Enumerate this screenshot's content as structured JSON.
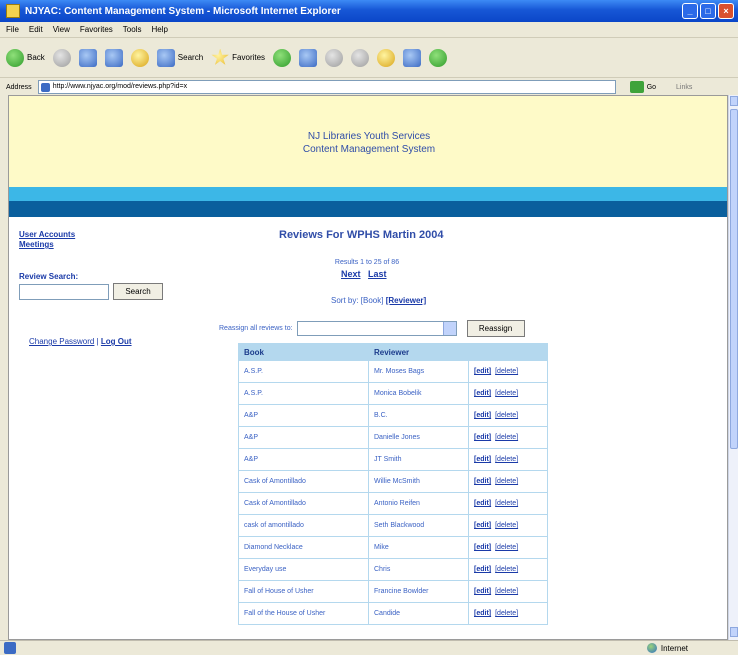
{
  "window": {
    "title": "NJYAC: Content Management System - Microsoft Internet Explorer",
    "buttons": [
      "_",
      "□",
      "×"
    ]
  },
  "menu": [
    "File",
    "Edit",
    "View",
    "Favorites",
    "Tools",
    "Help"
  ],
  "toolbar": {
    "back_label": "Back",
    "search_label": "Search",
    "favorites_label": "Favorites"
  },
  "address": {
    "label": "Address",
    "url": "http://www.njyac.org/mod/reviews.php?id=x",
    "go_label": "Go",
    "links_label": "Links"
  },
  "site": {
    "title_line1": "NJ Libraries Youth Services",
    "title_line2": "Content Management System"
  },
  "sidebar": {
    "items": [
      {
        "label": "User Accounts"
      },
      {
        "label": "Meetings"
      }
    ],
    "review_search_label": "Review Search:",
    "search_button": "Search",
    "change_password": "Change Password",
    "separator": " | ",
    "log_out": "Log Out"
  },
  "main": {
    "heading": "Reviews For WPHS Martin 2004",
    "results": "Results 1 to 25 of 86",
    "next": "Next",
    "last": "Last",
    "sort_prefix": "Sort by: ",
    "sort_book": "[Book]",
    "sort_reviewer": "[Reviewer]",
    "reassign_label": "Reassign all reviews to:",
    "reassign_button": "Reassign",
    "columns": [
      "Book",
      "Reviewer",
      ""
    ],
    "edit_label": "[edit]",
    "delete_label": "[delete]",
    "rows": [
      {
        "book": "A.S.P.",
        "reviewer": "Mr. Moses Bags"
      },
      {
        "book": "A.S.P.",
        "reviewer": "Monica Bobelik"
      },
      {
        "book": "A&P",
        "reviewer": "B.C."
      },
      {
        "book": "A&P",
        "reviewer": "Danielle Jones"
      },
      {
        "book": "A&P",
        "reviewer": "JT Smith"
      },
      {
        "book": "Cask of Amontillado",
        "reviewer": "Willie McSmith"
      },
      {
        "book": "Cask of Amontillado",
        "reviewer": "Antonio Reifen"
      },
      {
        "book": "cask of amontillado",
        "reviewer": "Seth Blackwood"
      },
      {
        "book": "Diamond Necklace",
        "reviewer": "Mike"
      },
      {
        "book": "Everyday use",
        "reviewer": "Chris"
      },
      {
        "book": "Fall of House of Usher",
        "reviewer": "Francine Bowlder"
      },
      {
        "book": "Fall of the House of Usher",
        "reviewer": "Candide"
      }
    ]
  },
  "status": {
    "zone": "Internet"
  }
}
